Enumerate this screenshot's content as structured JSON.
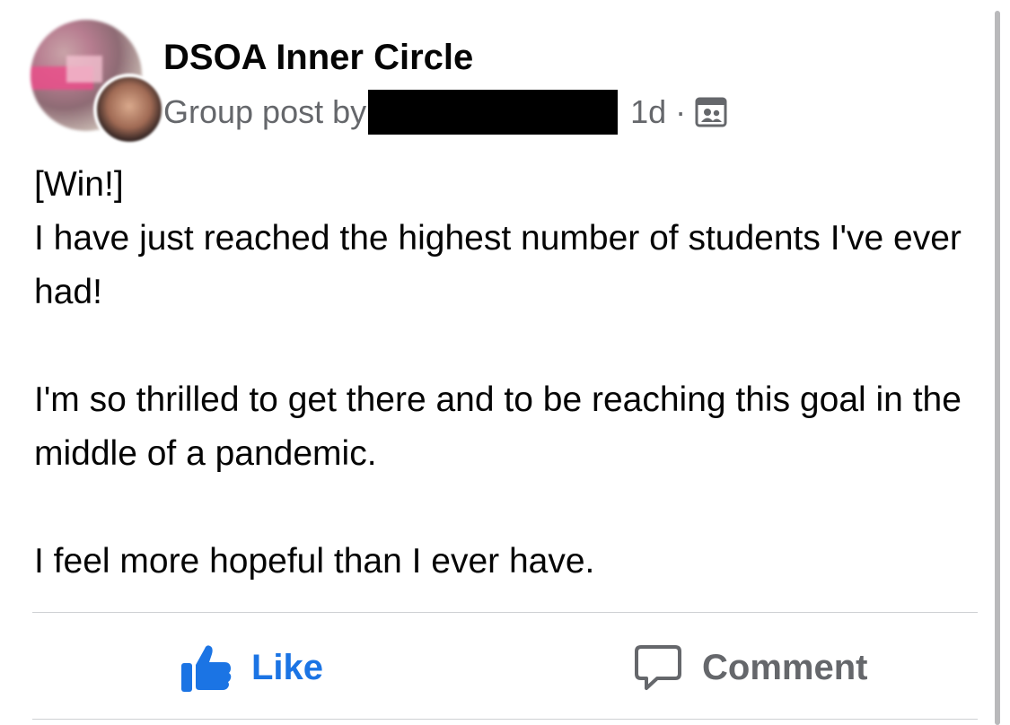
{
  "post": {
    "group_name": "DSOA Inner Circle",
    "byline_prefix": "Group post by",
    "time_ago": "1d",
    "separator": "·",
    "audience_icon": "group-audience-icon",
    "body": {
      "tag": "[Win!]",
      "line1": "I have just reached the highest number of students I've ever had!",
      "line2": "I'm so thrilled to get there and to be reaching this goal in the middle of a pandemic.",
      "line3": "I feel more hopeful than I ever have."
    }
  },
  "actions": {
    "like_label": "Like",
    "comment_label": "Comment"
  },
  "colors": {
    "like_blue": "#1b74e4",
    "secondary_text": "#65676b",
    "primary_text": "#050505",
    "divider": "#ced0d4"
  }
}
